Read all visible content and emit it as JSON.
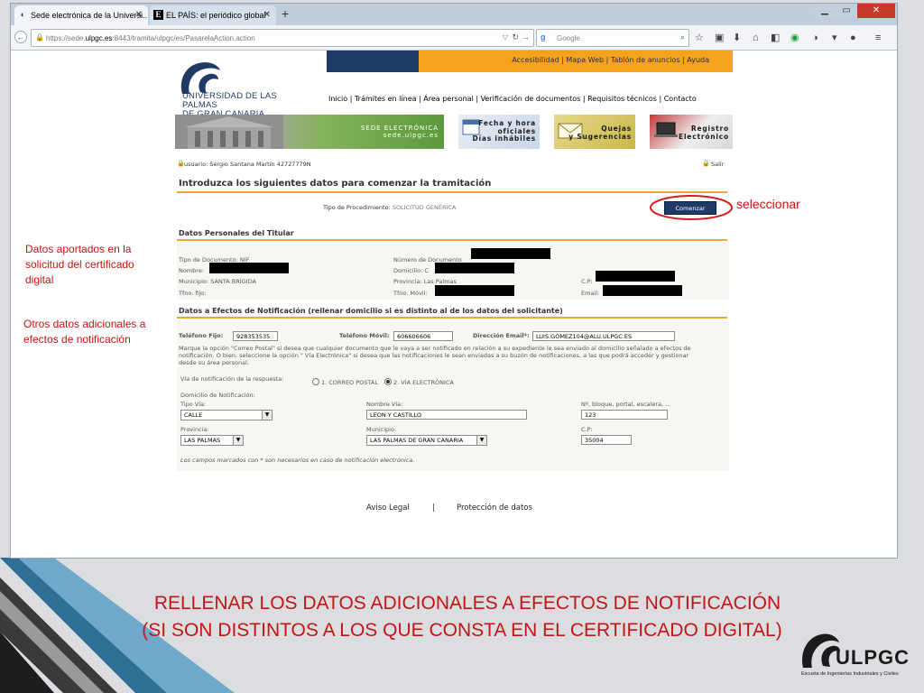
{
  "browser": {
    "tabs": [
      {
        "label": "Sede electrónica de la Universi...",
        "active": true
      },
      {
        "label": "EL PAÍS: el periódico global",
        "active": false
      }
    ],
    "new_tab": "+",
    "url": "https://sede.ulpgc.es:8443/tramita/ulpgc/es/PasarelaAction.action",
    "url_prefix": "https://sede.",
    "url_domain": "ulpgc.es",
    "url_rest": ":8443/tramita/ulpgc/es/PasarelaAction.action",
    "search_placeholder": "Google",
    "accent": "#bfcddc"
  },
  "site": {
    "utility_nav": "Accesibilidad | Mapa Web | Tablón de anuncios | Ayuda",
    "logo_line1": "UNIVERSIDAD DE LAS PALMAS",
    "logo_line2": "DE GRAN CANARIA",
    "main_menu": "Inicio  |  Trámites en línea  |  Área personal  |  Verificación de documentos  |  Requisitos técnicos  |  Contacto",
    "banners": {
      "sede_line1": "SEDE ELECTRÓNICA",
      "sede_line2": "sede.ulpgc.es",
      "fecha_line1": "Fecha y hora",
      "fecha_line2": "oficiales",
      "fecha_line3": "Días inhábiles",
      "quejas_line1": "Quejas",
      "quejas_line2": "y Sugerencias",
      "registro_line1": "Registro",
      "registro_line2": "Electrónico"
    },
    "user_label": "usuario: Sergio Santana Martín 42727779N",
    "exit_label": "Salir",
    "heading": "Introduzca los siguientes datos para comenzar la tramitación",
    "procedure_label": "Tipo de Procedimiento:",
    "procedure_value": "SOLICITUD GENÉRICA",
    "start_button": "Comenzar",
    "personal": {
      "heading": "Datos Personales del Titular",
      "doc_type_label": "Tipo de Documento:",
      "doc_type_value": "NIF",
      "doc_number_label": "Número de Documento",
      "name_label": "Nombre:",
      "address_label": "Domicilio:",
      "address_prefix": "C",
      "municipality_label": "Municipio:",
      "municipality_value": "SANTA BRÍGIDA",
      "province_label": "Provincia:",
      "province_value": "Las Palmas",
      "cp_label": "C.P:",
      "phone_label": "Tfno. fijo:",
      "mobile_label": "Tfno. Móvil:",
      "email_label": "Email:"
    },
    "notification": {
      "heading": "Datos a Efectos de Notificación (rellenar domicilio si es distinto al de los datos del solicitante)",
      "phone_label": "Teléfono Fijo:",
      "phone_value": "928353535",
      "mobile_label": "Teléfono Móvil:",
      "mobile_value": "606606606",
      "email_label": "Dirección Email*:",
      "email_value": "LUIS.GOMEZ104@ALU.ULPGC.ES",
      "note_line1": "Marque la opción \"Correo Postal\" si desea que cualquier documento que le vaya a ser notificado en relación a su expediente le sea enviado al domicilio señalado a efectos de",
      "note_line2": "notificación. O bien, seleccione la opción \" Vía Electrónica\" si desea que las notificaciones le sean enviadas a su buzón de notificaciones, a las que podrá acceder y gestionar",
      "note_line3": "desde su área personal.",
      "via_label": "Vía de notificación de la respuesta:",
      "via_option1": "1. CORREO POSTAL",
      "via_option2": "2. VÍA ELECTRÓNICA",
      "via_selected": 2,
      "domicile_label": "Domicilio de Notificación:",
      "street_type_label": "Tipo Vía:",
      "street_type_value": "CALLE",
      "street_name_label": "Nombre Vía:",
      "street_name_value": "LEON Y CASTILLO",
      "number_label": "Nº, bloque, portal, escalera, ...",
      "number_value": "123",
      "province_label": "Provincia:",
      "province_value": "LAS PALMAS",
      "municipality_label": "Municipio:",
      "municipality_value": "LAS PALMAS DE GRAN CANARIA",
      "cp_label": "C.P:",
      "cp_value": "35004",
      "required_note": "Los campos marcados con * son necesarios en caso de notificación electrónica."
    },
    "footer": {
      "legal": "Aviso Legal",
      "separator": "|",
      "privacy": "Protección de datos"
    }
  },
  "slide": {
    "annotation_select": "seleccionar",
    "annotation_personal": "Datos aportados en la solicitud del certificado digital",
    "annotation_other": "Otros datos adicionales a efectos de notificación",
    "title_line1": "RELLENAR LOS DATOS ADICIONALES A EFECTOS DE NOTIFICACIÓN",
    "title_line2": "(SI SON DISTINTOS A LOS QUE CONSTA EN EL CERTIFICADO DIGITAL)",
    "logo_text": "ULPGC",
    "logo_subtitle": "Escuela de Ingenierías Industriales y Civiles",
    "accent": "#c41414"
  }
}
